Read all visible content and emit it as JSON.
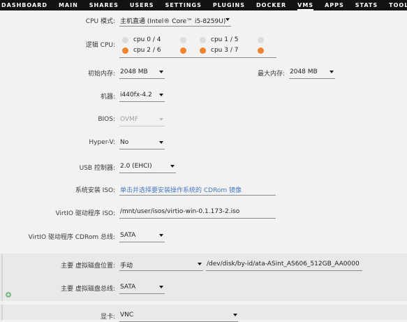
{
  "nav": {
    "tabs": [
      {
        "label": "DASHBOARD"
      },
      {
        "label": "MAIN"
      },
      {
        "label": "SHARES"
      },
      {
        "label": "USERS"
      },
      {
        "label": "SETTINGS"
      },
      {
        "label": "PLUGINS"
      },
      {
        "label": "DOCKER"
      },
      {
        "label": "VMS",
        "active": true
      },
      {
        "label": "APPS"
      },
      {
        "label": "STATS"
      },
      {
        "label": "TOOLS"
      }
    ]
  },
  "form": {
    "cpu_mode": {
      "label": "CPU 模式:",
      "value": "主机直通 (Intel® Core™ i5-8259U)"
    },
    "logical_cpu": {
      "label": "逻辑 CPU:",
      "cpus": [
        {
          "label": "cpu 0 / 4",
          "checked": false
        },
        {
          "label": "cpu 1 / 5",
          "checked": false
        },
        {
          "label": "cpu 2 / 6",
          "checked": true
        },
        {
          "label": "cpu 3 / 7",
          "checked": true
        }
      ]
    },
    "initial_memory": {
      "label": "初始内存:",
      "value": "2048 MB"
    },
    "max_memory": {
      "label": "最大内存:",
      "value": "2048 MB"
    },
    "machine": {
      "label": "机器:",
      "value": "i440fx-4.2"
    },
    "bios": {
      "label": "BIOS:",
      "value": "OVMF"
    },
    "hyperv": {
      "label": "Hyper-V:",
      "value": "No"
    },
    "usb": {
      "label": "USB 控制器:",
      "value": "2.0 (EHCI)"
    },
    "os_iso": {
      "label": "系统安装 ISO:",
      "value": "单击并选择要安装操作系统的 CDRom 镜像"
    },
    "virtio_iso": {
      "label": "VirtIO 驱动程序 ISO:",
      "value": "/mnt/user/isos/virtio-win-0.1.173-2.iso"
    },
    "virtio_bus": {
      "label": "VirtIO 驱动程序 CDRom 总线:",
      "value": "SATA"
    },
    "primary_disk_location": {
      "label": "主要 虚拟磁盘位置:",
      "value": "手动",
      "path": "/dev/disk/by-id/ata-ASint_AS606_512GB_AA0000"
    },
    "primary_disk_bus": {
      "label": "主要 虚拟磁盘总线:",
      "value": "SATA"
    },
    "graphics": {
      "label": "显卡:",
      "value": "VNC"
    }
  },
  "colors": {
    "accent": "#f0822e",
    "link": "#4a7cbf",
    "nav_bg": "#121212"
  }
}
